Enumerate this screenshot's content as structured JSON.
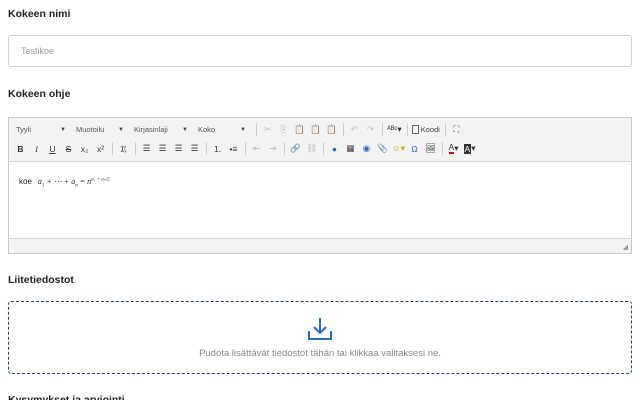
{
  "exam_name": {
    "label": "Kokeen nimi",
    "value": "Testikoe"
  },
  "instructions": {
    "label": "Kokeen ohje",
    "toolbar": {
      "style_combo": "Tyyli",
      "format_combo": "Muotoilu",
      "font_combo": "Kirjasinlaji",
      "size_combo": "Koko",
      "source_button": "Koodi"
    },
    "content": {
      "text": "koe",
      "formula_lhs": "a",
      "formula_sub1": "1",
      "formula_mid": " + ⋯ + a",
      "formula_subn": "n",
      "formula_eq": " = n",
      "formula_exp": "a₁ + aₙ",
      "formula_exp_den": "2"
    }
  },
  "attachments": {
    "label": "Liitetiedostot",
    "drop_text": "Pudota lisättävät tiedostot tähän tai klikkaa valitaksesi ne."
  },
  "next_section_label": "Kysymykset ja arviointi",
  "colors": {
    "dropzone_border": "#1f3a8a",
    "toolbar_bg": "#f3f3f3",
    "icon_blue": "#2a6bbf"
  }
}
